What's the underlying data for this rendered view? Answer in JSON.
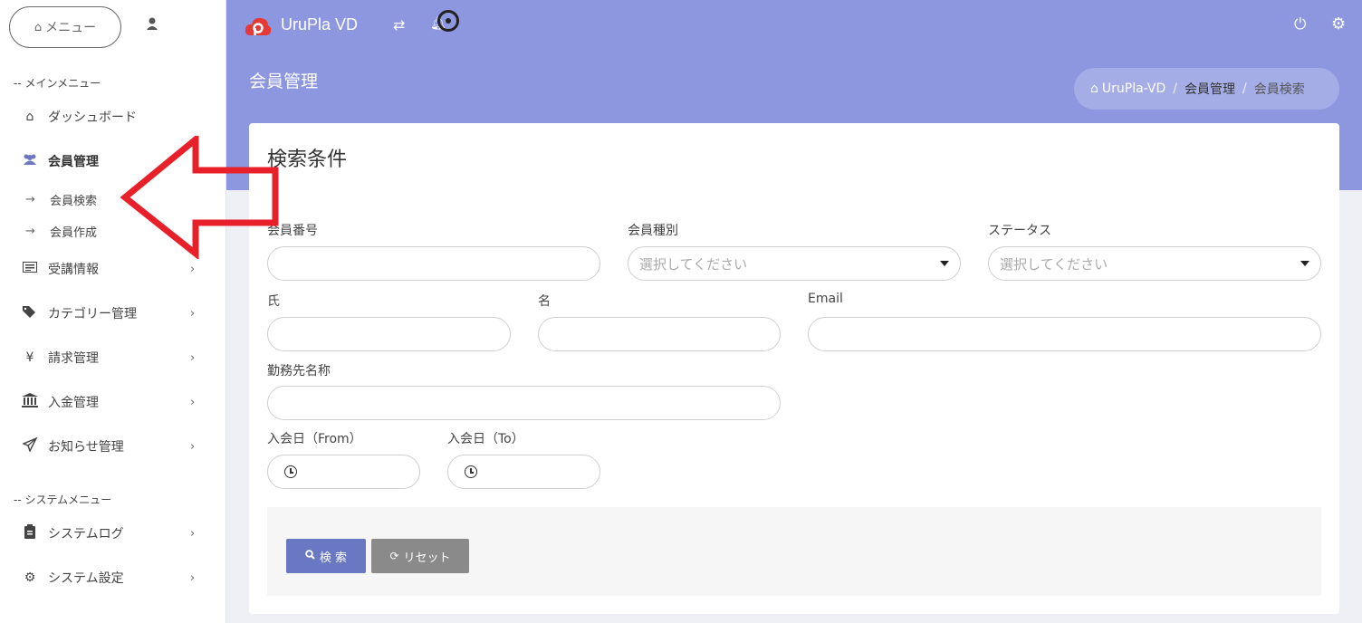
{
  "sidebar": {
    "menu_button_label": "メニュー",
    "main_menu_label": "-- メインメニュー",
    "system_menu_label": "-- システムメニュー",
    "items": [
      {
        "label": "ダッシュボード",
        "icon": "home-icon"
      },
      {
        "label": "会員管理",
        "icon": "users-icon"
      },
      {
        "label": "受講情報",
        "icon": "list-icon"
      },
      {
        "label": "カテゴリー管理",
        "icon": "tags-icon"
      },
      {
        "label": "請求管理",
        "icon": "yen-icon"
      },
      {
        "label": "入金管理",
        "icon": "bank-icon"
      },
      {
        "label": "お知らせ管理",
        "icon": "paper-plane-icon"
      }
    ],
    "subitems": [
      {
        "label": "会員検索"
      },
      {
        "label": "会員作成"
      }
    ],
    "system_items": [
      {
        "label": "システムログ",
        "icon": "clipboard-icon"
      },
      {
        "label": "システム設定",
        "icon": "cogs-icon"
      }
    ]
  },
  "header": {
    "app_title": "UruPla VD"
  },
  "page": {
    "title": "会員管理",
    "breadcrumb": [
      "UruPla-VD",
      "会員管理",
      "会員検索"
    ]
  },
  "form": {
    "title": "検索条件",
    "member_number_label": "会員番号",
    "member_type_label": "会員種別",
    "member_type_placeholder": "選択してください",
    "status_label": "ステータス",
    "status_placeholder": "選択してください",
    "last_name_label": "氏",
    "first_name_label": "名",
    "email_label": "Email",
    "company_label": "勤務先名称",
    "join_from_label": "入会日（From）",
    "join_to_label": "入会日（To）",
    "search_button": "検 索",
    "reset_button": "リセット"
  },
  "colors": {
    "header": "#8c97df",
    "primary_button": "#6a77c3",
    "reset_button": "#8a8a8a",
    "annotation_arrow": "#e8202a"
  }
}
